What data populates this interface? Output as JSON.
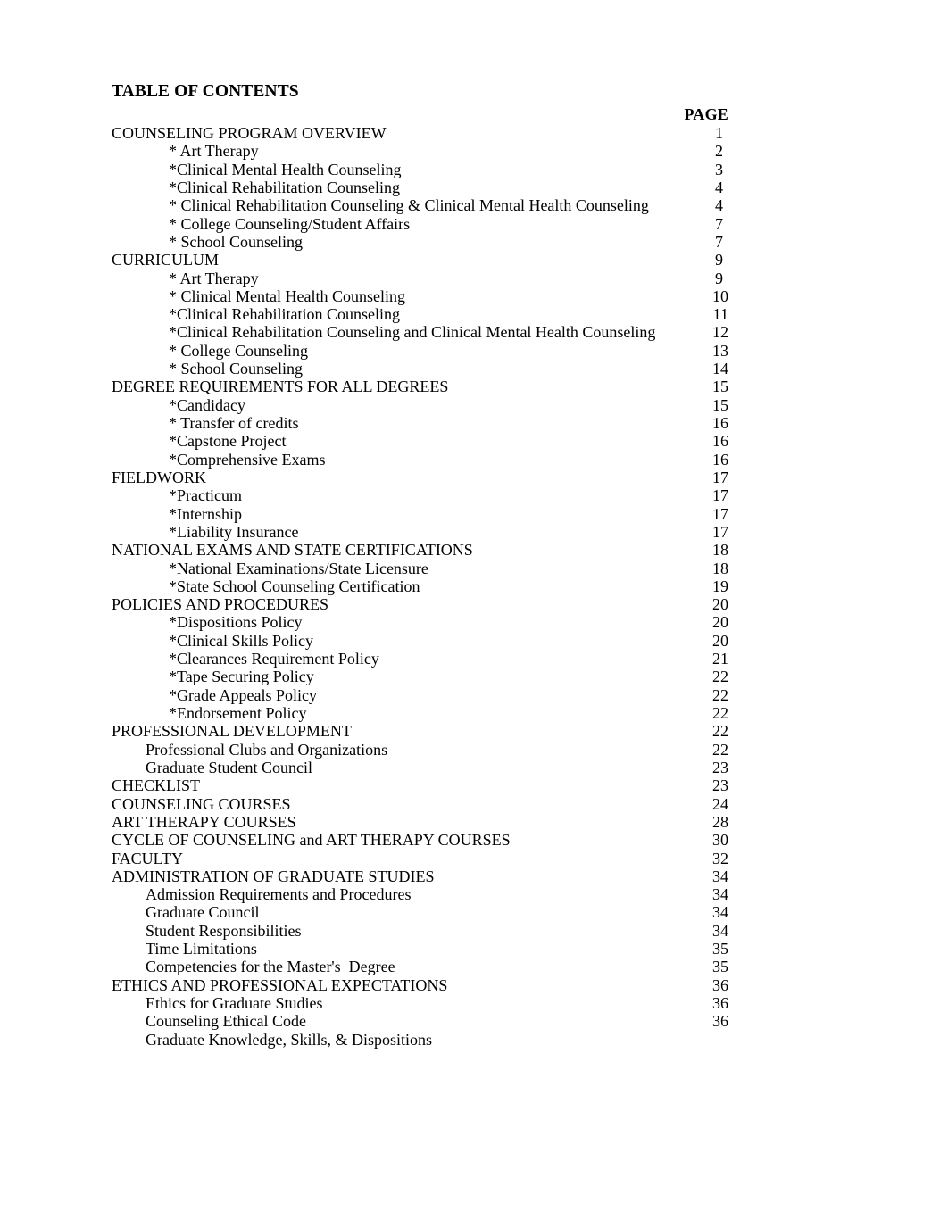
{
  "document": {
    "title": "TABLE OF CONTENTS",
    "page_column_header": "PAGE"
  },
  "entries": [
    {
      "label": "COUNSELING PROGRAM OVERVIEW",
      "page": "1",
      "level": 0
    },
    {
      "label": "* Art Therapy",
      "page": "2",
      "level": 2
    },
    {
      "label": "*Clinical Mental Health Counseling",
      "page": "3",
      "level": 2
    },
    {
      "label": "*Clinical Rehabilitation Counseling",
      "page": "4",
      "level": 2
    },
    {
      "label": "* Clinical Rehabilitation Counseling & Clinical Mental Health Counseling",
      "page": "4",
      "level": 2
    },
    {
      "label": "* College Counseling/Student Affairs",
      "page": "7",
      "level": 2
    },
    {
      "label": "* School Counseling",
      "page": "7",
      "level": 2
    },
    {
      "label": "CURRICULUM",
      "page": "9",
      "level": 0
    },
    {
      "label": "* Art Therapy",
      "page": "9",
      "level": 2
    },
    {
      "label": "* Clinical Mental Health Counseling",
      "page": "10",
      "level": 2
    },
    {
      "label": "*Clinical Rehabilitation Counseling",
      "page": "11",
      "level": 2
    },
    {
      "label": "*Clinical Rehabilitation Counseling and Clinical Mental Health Counseling",
      "page": "12",
      "level": 2
    },
    {
      "label": "* College Counseling",
      "page": "13",
      "level": 2
    },
    {
      "label": "* School Counseling",
      "page": "14",
      "level": 2
    },
    {
      "label": "DEGREE REQUIREMENTS FOR ALL DEGREES",
      "page": "15",
      "level": 0
    },
    {
      "label": "*Candidacy",
      "page": "15",
      "level": 2
    },
    {
      "label": "* Transfer of credits",
      "page": "16",
      "level": 2
    },
    {
      "label": "*Capstone Project",
      "page": "16",
      "level": 2
    },
    {
      "label": "*Comprehensive Exams",
      "page": "16",
      "level": 2
    },
    {
      "label": "FIELDWORK",
      "page": "17",
      "level": 0
    },
    {
      "label": "*Practicum",
      "page": "17",
      "level": 2
    },
    {
      "label": "*Internship",
      "page": "17",
      "level": 2
    },
    {
      "label": "*Liability Insurance",
      "page": "17",
      "level": 2
    },
    {
      "label": "NATIONAL EXAMS AND STATE CERTIFICATIONS",
      "page": "18",
      "level": 0
    },
    {
      "label": "*National Examinations/State Licensure",
      "page": "18",
      "level": 2
    },
    {
      "label": "*State School Counseling Certification",
      "page": "19",
      "level": 2
    },
    {
      "label": "POLICIES AND PROCEDURES",
      "page": "20",
      "level": 0
    },
    {
      "label": "*Dispositions Policy",
      "page": "20",
      "level": 2
    },
    {
      "label": "*Clinical Skills Policy",
      "page": "20",
      "level": 2
    },
    {
      "label": "*Clearances Requirement Policy",
      "page": "21",
      "level": 2
    },
    {
      "label": "*Tape Securing Policy",
      "page": "22",
      "level": 2
    },
    {
      "label": "*Grade Appeals Policy",
      "page": "22",
      "level": 2
    },
    {
      "label": "*Endorsement Policy",
      "page": "22",
      "level": 2
    },
    {
      "label": "PROFESSIONAL DEVELOPMENT",
      "page": "22",
      "level": 0
    },
    {
      "label": "Professional Clubs and Organizations",
      "page": "22",
      "level": 1
    },
    {
      "label": "Graduate Student Council",
      "page": "23",
      "level": 1
    },
    {
      "label": "CHECKLIST",
      "page": "23",
      "level": 0
    },
    {
      "label": "COUNSELING COURSES",
      "page": "24",
      "level": 0
    },
    {
      "label": "ART THERAPY COURSES",
      "page": "28",
      "level": 0
    },
    {
      "label": "CYCLE OF COUNSELING and ART THERAPY COURSES",
      "page": "30",
      "level": 0
    },
    {
      "label": "FACULTY",
      "page": "32",
      "level": 0
    },
    {
      "label": "ADMINISTRATION OF GRADUATE STUDIES",
      "page": "34",
      "level": 0
    },
    {
      "label": "Admission Requirements and Procedures",
      "page": "34",
      "level": 1
    },
    {
      "label": "Graduate Council",
      "page": "34",
      "level": 1
    },
    {
      "label": "Student Responsibilities",
      "page": "34",
      "level": 1
    },
    {
      "label": "Time Limitations",
      "page": "35",
      "level": 1
    },
    {
      "label": "Competencies for the Master's  Degree",
      "page": "35",
      "level": 1
    },
    {
      "label": "ETHICS AND PROFESSIONAL EXPECTATIONS",
      "page": "36",
      "level": 0
    },
    {
      "label": "Ethics for Graduate Studies",
      "page": "36",
      "level": 1
    },
    {
      "label": "Counseling Ethical Code",
      "page": "36",
      "level": 1
    },
    {
      "label": "Graduate Knowledge, Skills, & Dispositions",
      "page": "",
      "level": 1
    }
  ]
}
